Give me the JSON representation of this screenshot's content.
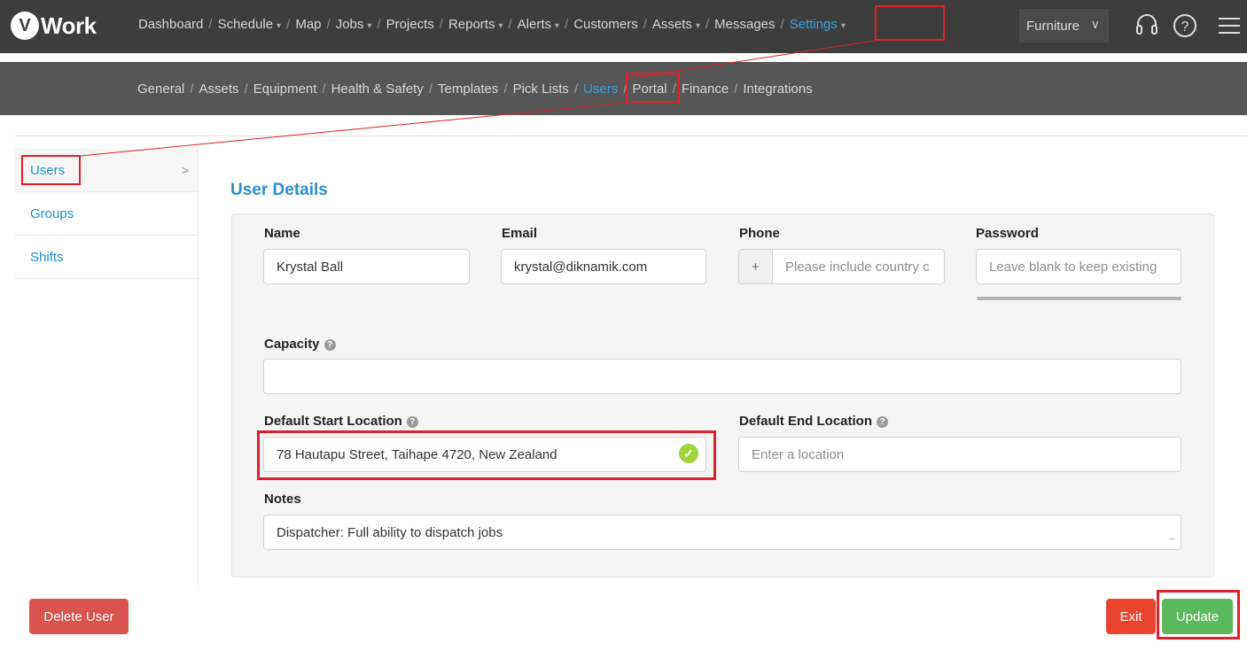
{
  "app": {
    "logo_letter": "V",
    "logo_text": "Work"
  },
  "main_nav": [
    {
      "label": "Dashboard",
      "dropdown": false,
      "active": false
    },
    {
      "label": "Schedule",
      "dropdown": true,
      "active": false
    },
    {
      "label": "Map",
      "dropdown": false,
      "active": false
    },
    {
      "label": "Jobs",
      "dropdown": true,
      "active": false
    },
    {
      "label": "Projects",
      "dropdown": false,
      "active": false
    },
    {
      "label": "Reports",
      "dropdown": true,
      "active": false
    },
    {
      "label": "Alerts",
      "dropdown": true,
      "active": false
    },
    {
      "label": "Customers",
      "dropdown": false,
      "active": false
    },
    {
      "label": "Assets",
      "dropdown": true,
      "active": false
    },
    {
      "label": "Messages",
      "dropdown": false,
      "active": false
    },
    {
      "label": "Settings",
      "dropdown": true,
      "active": true
    }
  ],
  "org_selector": {
    "label": "Furniture"
  },
  "top_icons": [
    "headset-icon",
    "help-icon",
    "menu-icon"
  ],
  "settings_nav": [
    {
      "label": "General",
      "active": false
    },
    {
      "label": "Assets",
      "active": false
    },
    {
      "label": "Equipment",
      "active": false
    },
    {
      "label": "Health & Safety",
      "active": false
    },
    {
      "label": "Templates",
      "active": false
    },
    {
      "label": "Pick Lists",
      "active": false
    },
    {
      "label": "Users",
      "active": true
    },
    {
      "label": "Portal",
      "active": false
    },
    {
      "label": "Finance",
      "active": false
    },
    {
      "label": "Integrations",
      "active": false
    }
  ],
  "sidebar": {
    "items": [
      {
        "label": "Users",
        "active": true
      },
      {
        "label": "Groups",
        "active": false
      },
      {
        "label": "Shifts",
        "active": false
      }
    ]
  },
  "form": {
    "title": "User Details",
    "name": {
      "label": "Name",
      "value": "Krystal Ball"
    },
    "email": {
      "label": "Email",
      "value": "krystal@diknamik.com"
    },
    "phone": {
      "label": "Phone",
      "prefix": "+",
      "placeholder": "Please include country c"
    },
    "password": {
      "label": "Password",
      "placeholder": "Leave blank to keep existing"
    },
    "capacity": {
      "label": "Capacity",
      "value": ""
    },
    "start_location": {
      "label": "Default Start Location",
      "value": "78 Hautapu Street, Taihape 4720, New Zealand"
    },
    "end_location": {
      "label": "Default End Location",
      "placeholder": "Enter a location"
    },
    "notes": {
      "label": "Notes",
      "value": "Dispatcher: Full ability to dispatch jobs"
    }
  },
  "buttons": {
    "delete": "Delete User",
    "exit": "Exit",
    "update": "Update"
  },
  "colors": {
    "accent": "#3aa0e0",
    "highlight": "#e0202b",
    "update": "#5cb85c",
    "delete": "#d9534f",
    "exit": "#e8442e",
    "valid": "#9dd53a"
  }
}
